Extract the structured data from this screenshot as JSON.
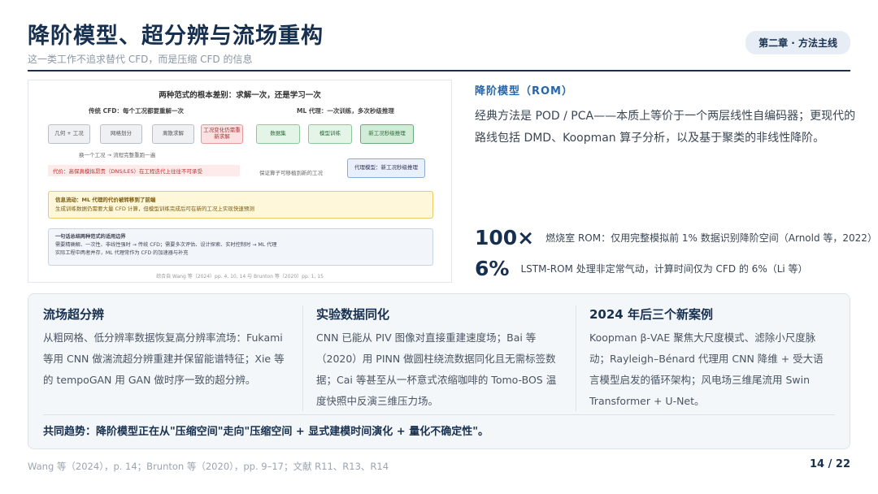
{
  "header": {
    "title": "降阶模型、超分辨与流场重构",
    "subtitle": "这一类工作不追求替代 CFD，而是压缩 CFD 的信息",
    "chapter_badge": "第二章 · 方法主线"
  },
  "figure": {
    "title": "两种范式的根本差别：求解一次，还是学习一次",
    "left_head": "传统 CFD：每个工况都要重解一次",
    "right_head": "ML 代理：一次训练，多次秒级推理",
    "left_boxes": [
      "几何 + 工况",
      "网格划分",
      "离散求解",
      "工况变化仍需重新求解"
    ],
    "right_boxes": [
      "数据集",
      "模型训练",
      "新工况秒级推理"
    ],
    "left_note": "换一个工况 → 流程完整重跑一遍",
    "left_red": "代价：高保真模拟昂贵（DNS/LES）在工程迭代上往往不可承受",
    "right_note": "代理模型：新工况秒级推理",
    "right_note2": "保证算子可移植到新的工况",
    "yellow_line1": "信息流动：ML 代理的代价被转移到了前端",
    "yellow_line2": "生成训练数据仍需要大量 CFD 计算，但模型训练完成后可在新的工况上实现快速预测",
    "blue_line1": "一句话总结两种范式的适用边界",
    "blue_line2": "需要精确解、一次性、非线性强时 → 传统 CFD；需要多次评估、设计探索、实时控制时 → ML 代理",
    "blue_line3": "实际工程中两者并存，ML 代理常作为 CFD 的加速器与补充",
    "caption": "综合自 Wang 等（2024）pp. 4, 10, 14 与 Brunton 等（2020）pp. 1, 15"
  },
  "rom": {
    "heading": "降阶模型（ROM）",
    "body": "经典方法是 POD / PCA——本质上等价于一个两层线性自编码器；更现代的路线包括 DMD、Koopman 算子分析，以及基于聚类的非线性降阶。"
  },
  "stats": [
    {
      "num": "100×",
      "text": "燃烧室 ROM：仅用完整模拟前 1% 数据识别降阶空间（Arnold 等，2022）"
    },
    {
      "num": "6%",
      "text": "LSTM-ROM 处理非定常气动，计算时间仅为 CFD 的 6%（Li 等）"
    }
  ],
  "columns": [
    {
      "heading": "流场超分辨",
      "body": "从粗网格、低分辨率数据恢复高分辨率流场：Fukami 等用 CNN 做湍流超分辨重建并保留能谱特征；Xie 等的 tempoGAN 用 GAN 做时序一致的超分辨。"
    },
    {
      "heading": "实验数据同化",
      "body": "CNN 已能从 PIV 图像对直接重建速度场；Bai 等（2020）用 PINN 做圆柱绕流数据同化且无需标签数据；Cai 等甚至从一杯意式浓缩咖啡的 Tomo-BOS 温度快照中反演三维压力场。"
    },
    {
      "heading": "2024 年后三个新案例",
      "body": "Koopman β-VAE 聚焦大尺度模式、滤除小尺度脉动；Rayleigh–Bénard 代理用 CNN 降维 + 受大语言模型启发的循环架构；风电场三维尾流用 Swin Transformer + U-Net。"
    }
  ],
  "trend": "共同趋势：降阶模型正在从\"压缩空间\"走向\"压缩空间 + 显式建模时间演化 + 量化不确定性\"。",
  "footer": {
    "sources": "Wang 等（2024），p. 14；Brunton 等（2020），pp. 9–17；文献 R11、R13、R14",
    "page": "14 / 22"
  }
}
